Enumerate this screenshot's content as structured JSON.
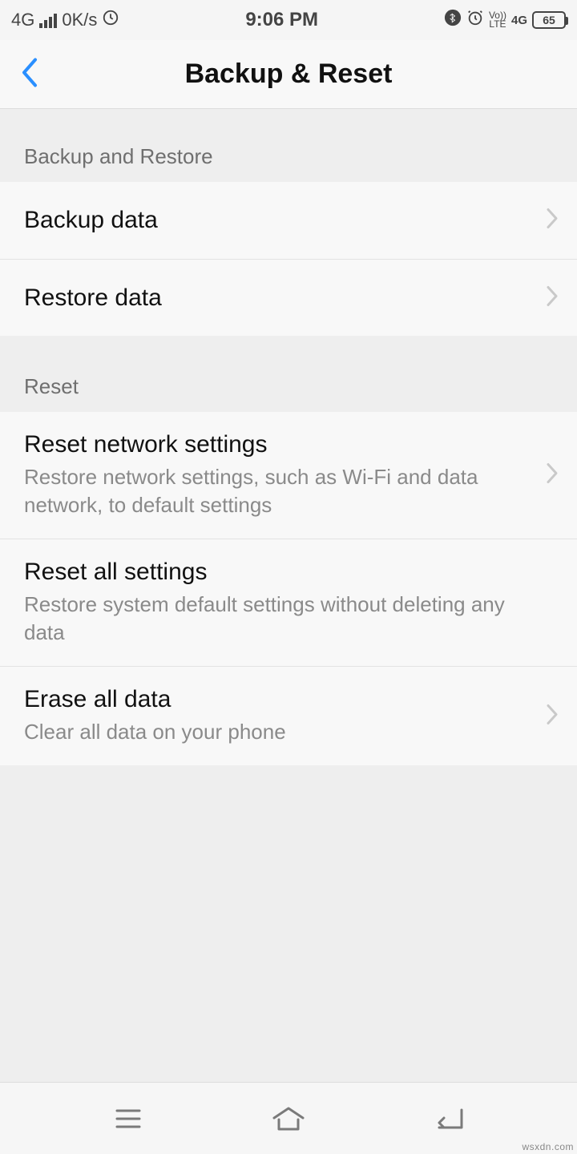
{
  "status": {
    "network_type": "4G",
    "data_speed": "0K/s",
    "time": "9:06 PM",
    "lte_top": "Vo))",
    "lte_bottom": "LTE",
    "net_badge": "4G",
    "battery_level": "65"
  },
  "header": {
    "title": "Backup & Reset"
  },
  "sections": {
    "backup": {
      "header": "Backup and Restore",
      "items": [
        {
          "title": "Backup data"
        },
        {
          "title": "Restore data"
        }
      ]
    },
    "reset": {
      "header": "Reset",
      "items": [
        {
          "title": "Reset network settings",
          "subtitle": "Restore network settings, such as Wi-Fi and data network, to default settings"
        },
        {
          "title": "Reset all settings",
          "subtitle": "Restore system default settings without deleting any data"
        },
        {
          "title": "Erase all data",
          "subtitle": "Clear all data on your phone"
        }
      ]
    }
  },
  "watermark": "wsxdn.com"
}
